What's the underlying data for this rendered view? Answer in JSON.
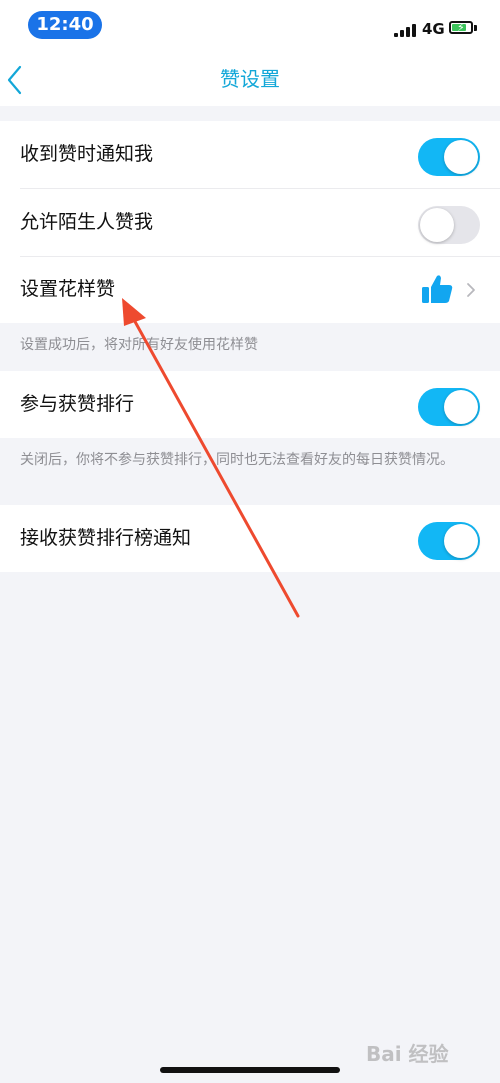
{
  "status_bar": {
    "time": "12:40",
    "network": "4G",
    "battery_charging": true
  },
  "nav": {
    "title": "赞设置",
    "back_icon": "chevron-left-icon"
  },
  "settings": {
    "notify_like": {
      "label": "收到赞时通知我",
      "on": true
    },
    "allow_stranger": {
      "label": "允许陌生人赞我",
      "on": false
    },
    "fancy_like": {
      "label": "设置花样赞",
      "icon": "thumbs-up-icon"
    },
    "fancy_hint": "设置成功后，将对所有好友使用花样赞",
    "ranking": {
      "label": "参与获赞排行",
      "on": true
    },
    "ranking_hint": "关闭后，你将不参与获赞排行，同时也无法查看好友的每日获赞情况。",
    "ranking_notify": {
      "label": "接收获赞排行榜通知",
      "on": true
    }
  },
  "watermark": "Bai 经验",
  "colors": {
    "accent": "#12b7f5",
    "title": "#13a7d8",
    "annotation_arrow": "#ee4a2f"
  }
}
